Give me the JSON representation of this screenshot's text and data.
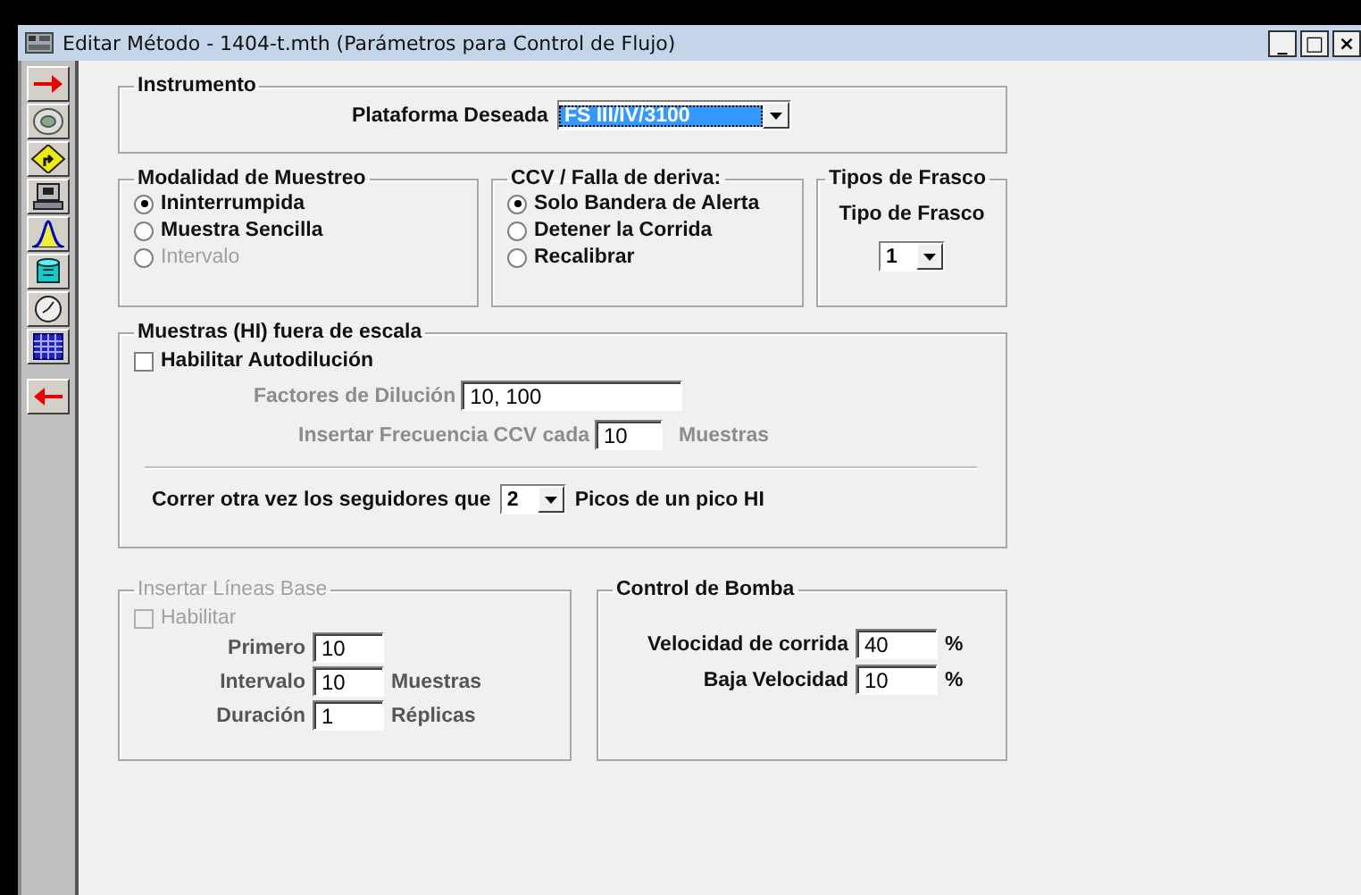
{
  "window": {
    "title": "Editar Método - 1404-t.mth (Parámetros para Control de Flujo)",
    "controls": [
      "_",
      "□",
      "×"
    ]
  },
  "instrumento": {
    "title": "Instrumento",
    "label": "Plataforma Deseada",
    "value": "FS III/IV/3100"
  },
  "modalidad": {
    "title": "Modalidad de Muestreo",
    "options": [
      {
        "label": "Ininterrumpida",
        "selected": true,
        "disabled": false
      },
      {
        "label": "Muestra Sencilla",
        "selected": false,
        "disabled": false
      },
      {
        "label": "Intervalo",
        "selected": false,
        "disabled": true
      }
    ]
  },
  "ccv": {
    "title": "CCV / Falla de deriva:",
    "options": [
      {
        "label": "Solo Bandera de Alerta",
        "selected": true,
        "disabled": false
      },
      {
        "label": "Detener la Corrida",
        "selected": false,
        "disabled": false
      },
      {
        "label": "Recalibrar",
        "selected": false,
        "disabled": false
      }
    ]
  },
  "frasco": {
    "title": "Tipos de Frasco",
    "label": "Tipo de Frasco",
    "value": "1"
  },
  "fuera": {
    "title": "Muestras (HI) fuera de escala",
    "autodilucion": {
      "label": "Habilitar Autodilución",
      "checked": false,
      "disabled": false
    },
    "fields": [
      {
        "label": "Factores de Dilución",
        "value": "10, 100",
        "disabled": true,
        "kind": "wide"
      },
      {
        "label": "Insertar Frecuencia CCV cada",
        "value": "10",
        "unit": "Muestras",
        "disabled": true,
        "kind": "short"
      }
    ],
    "correr": {
      "label": "Correr otra vez los seguidores que",
      "value": "2",
      "suffix": "Picos de un pico HI"
    }
  },
  "lineas": {
    "title": "Insertar Líneas Base",
    "disabled": true,
    "habilitar": {
      "label": "Habilitar",
      "checked": false,
      "disabled": true
    },
    "fields": [
      {
        "label": "Primero",
        "value": "10"
      },
      {
        "label": "Intervalo",
        "value": "10",
        "unit": "Muestras"
      },
      {
        "label": "Duración",
        "value": "1",
        "unit": "Réplicas"
      }
    ]
  },
  "bomba": {
    "title": "Control de Bomba",
    "fields": [
      {
        "label": "Velocidad de corrida",
        "value": "40",
        "unit": "%"
      },
      {
        "label": "Baja Velocidad",
        "value": "10",
        "unit": "%"
      }
    ]
  }
}
